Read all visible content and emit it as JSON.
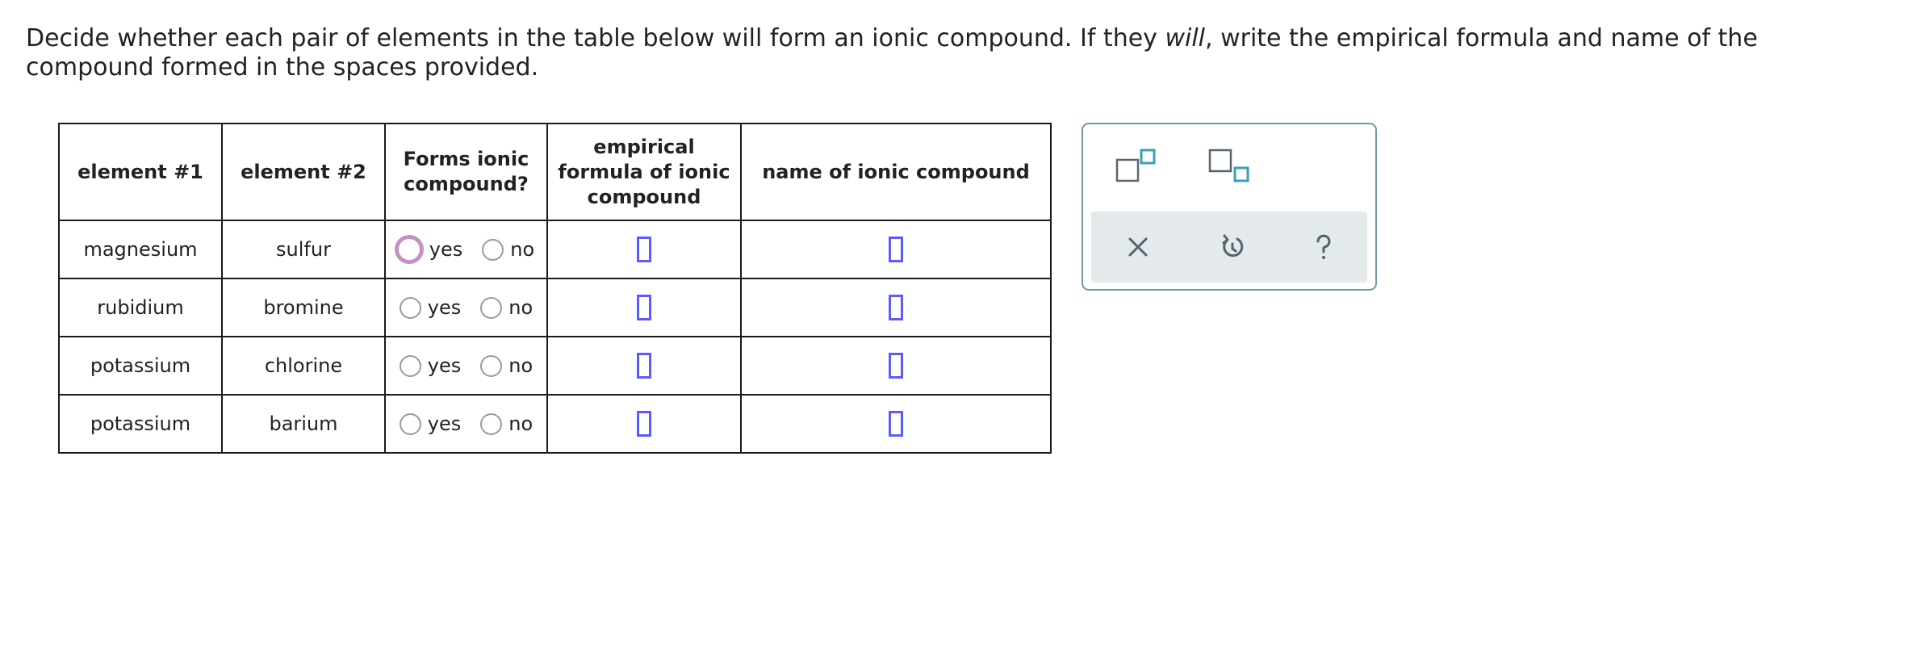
{
  "prompt": {
    "part1": "Decide whether each pair of elements in the table below will form an ionic compound. If they ",
    "emphasis": "will",
    "part2": ", write the empirical formula and name of the compound formed in the spaces provided."
  },
  "table": {
    "headers": {
      "element1": "element #1",
      "element2": "element #2",
      "forms_line1": "Forms ionic",
      "forms_line2": "compound?",
      "formula_line1": "empirical",
      "formula_line2": "formula of ionic",
      "formula_line3": "compound",
      "name": "name of ionic compound"
    },
    "yes_label": "yes",
    "no_label": "no",
    "rows": [
      {
        "element1": "magnesium",
        "element2": "sulfur"
      },
      {
        "element1": "rubidium",
        "element2": "bromine"
      },
      {
        "element1": "potassium",
        "element2": "chlorine"
      },
      {
        "element1": "potassium",
        "element2": "barium"
      }
    ]
  },
  "toolbox": {
    "buttons": [
      "superscript-icon",
      "subscript-icon",
      "clear-icon",
      "undo-icon",
      "help-icon"
    ],
    "accent_color": "#3aa0b4"
  },
  "colors": {
    "answer_box_border": "#5b5bff",
    "focus_ring": "#c590c2",
    "toolbox_border": "#6e9aa3",
    "toolbar_bg": "#e4e9eb"
  }
}
